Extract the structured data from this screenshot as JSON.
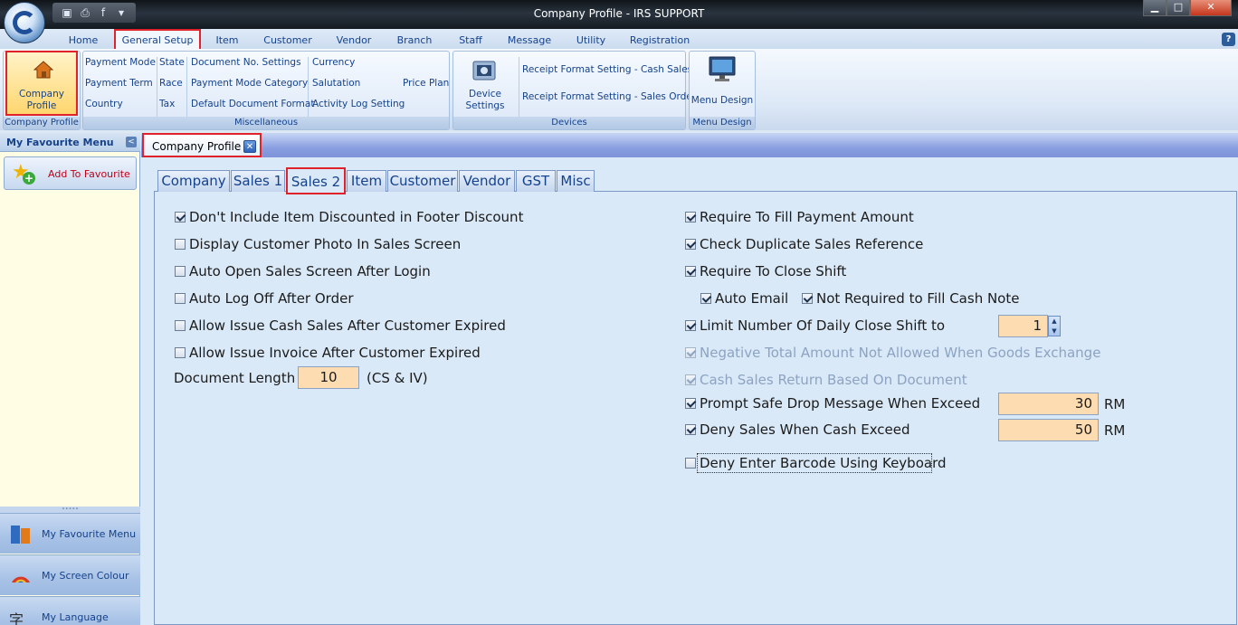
{
  "window": {
    "title": "Company Profile - IRS SUPPORT",
    "minimize": "▁",
    "maximize": "□",
    "close": "✕"
  },
  "quick_access": [
    "save-icon",
    "print-icon",
    "facebook-icon",
    "dropdown-icon"
  ],
  "menu": {
    "tabs": [
      "Home",
      "General Setup",
      "Item",
      "Customer",
      "Vendor",
      "Branch",
      "Staff",
      "Message",
      "Utility",
      "Registration"
    ],
    "active": "General Setup",
    "help": "?"
  },
  "ribbon": {
    "company_profile": {
      "label": "Company Profile",
      "group": "Company Profile"
    },
    "misc": {
      "group": "Miscellaneous",
      "col1": [
        "Payment Mode",
        "Payment Term",
        "Country"
      ],
      "col2": [
        "State",
        "Race",
        "Tax"
      ],
      "col3": [
        "Document No. Settings",
        "Payment Mode Category",
        "Default Document Format"
      ],
      "col4": [
        "Currency",
        "Salutation",
        "Activity Log Setting"
      ],
      "price_plan": "Price Plan"
    },
    "devices": {
      "group": "Devices",
      "device_settings": "Device Settings",
      "receipt_cash": "Receipt Format Setting - Cash  Sales",
      "receipt_order": "Receipt Format Setting - Sales Order"
    },
    "menu_design": {
      "label": "Menu Design",
      "group": "Menu Design"
    }
  },
  "left_panel": {
    "header": "My Favourite Menu",
    "collapse": "<",
    "add_favourite": "Add To Favourite",
    "nav": [
      "My Favourite Menu",
      "My Screen Colour",
      "My Language"
    ]
  },
  "document_tab": {
    "label": "Company Profile",
    "close": "✕"
  },
  "sub_tabs": [
    "Company",
    "Sales 1",
    "Sales 2",
    "Item",
    "Customer",
    "Vendor",
    "GST",
    "Misc"
  ],
  "active_sub_tab": "Sales 2",
  "left_options": [
    {
      "label": "Don't Include Item Discounted in Footer Discount",
      "checked": true
    },
    {
      "label": "Display Customer Photo In Sales Screen",
      "checked": false
    },
    {
      "label": "Auto Open Sales Screen After Login",
      "checked": false
    },
    {
      "label": "Auto Log Off After Order",
      "checked": false
    },
    {
      "label": "Allow Issue Cash Sales After Customer Expired",
      "checked": false
    },
    {
      "label": "Allow Issue Invoice After Customer Expired",
      "checked": false
    }
  ],
  "document_length": {
    "label": "Document Length",
    "value": "10",
    "suffix": "(CS & IV)"
  },
  "right_options": {
    "require_payment": {
      "label": "Require To Fill Payment Amount",
      "checked": true
    },
    "check_duplicate": {
      "label": "Check Duplicate Sales Reference",
      "checked": true
    },
    "require_close_shift": {
      "label": "Require To Close Shift",
      "checked": true
    },
    "auto_email": {
      "label": "Auto Email",
      "checked": true
    },
    "not_required_cash_note": {
      "label": "Not Required to Fill Cash Note",
      "checked": true
    },
    "limit_close_shift": {
      "label": "Limit Number Of Daily Close Shift to",
      "checked": true,
      "value": "1"
    },
    "negative_total": {
      "label": "Negative Total Amount Not Allowed When Goods Exchange",
      "checked": true,
      "disabled": true
    },
    "cash_sales_return": {
      "label": "Cash Sales Return Based On Document",
      "checked": true,
      "disabled": true
    },
    "prompt_safe_drop": {
      "label": "Prompt Safe Drop Message When Exceed",
      "checked": true,
      "value": "30",
      "unit": "RM"
    },
    "deny_sales": {
      "label": "Deny Sales When Cash Exceed",
      "checked": true,
      "value": "50",
      "unit": "RM"
    },
    "deny_barcode": {
      "label": "Deny Enter Barcode Using Keyboard",
      "checked": false
    }
  },
  "spin": {
    "up": "▲",
    "down": "▼"
  },
  "colors": {
    "highlight_border": "#e0232b",
    "field_bg": "#fddcb1",
    "ribbon_text": "#15428b"
  }
}
